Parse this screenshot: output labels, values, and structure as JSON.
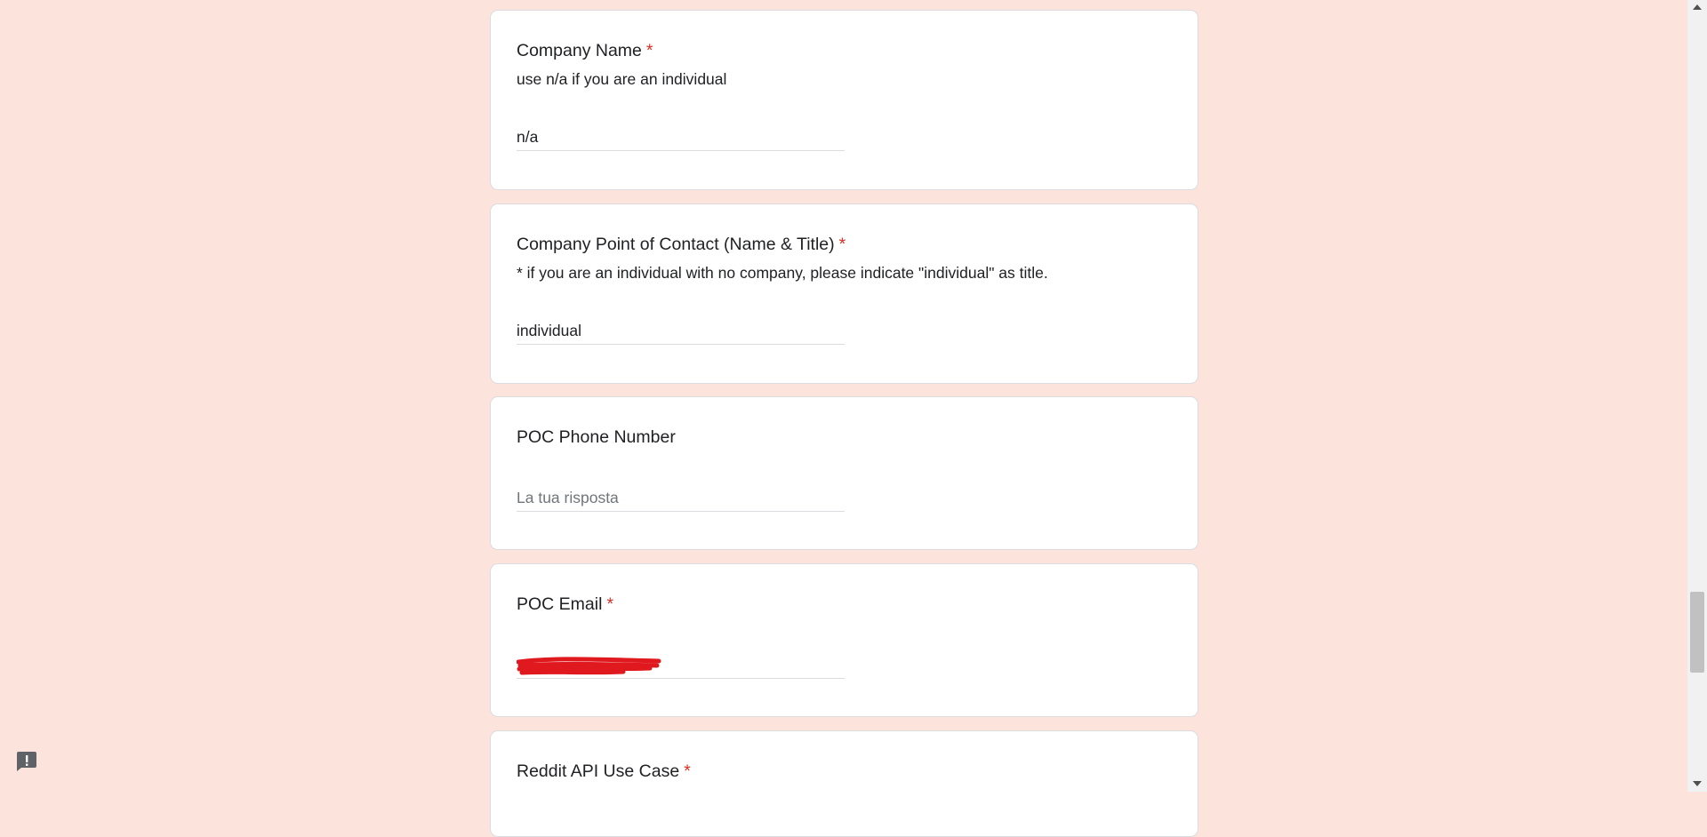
{
  "questions": {
    "company_name": {
      "title": "Company Name",
      "required": "*",
      "description": "use n/a if you are an individual",
      "value": "n/a"
    },
    "poc_contact": {
      "title": "Company Point of Contact (Name & Title)",
      "required": "*",
      "description": "* if you are an individual with no company, please indicate \"individual\" as title.",
      "value": "individual"
    },
    "poc_phone": {
      "title": "POC Phone Number",
      "placeholder": "La tua risposta"
    },
    "poc_email": {
      "title": "POC Email",
      "required": "*",
      "value": "[redacted]"
    },
    "api_use_case": {
      "title": "Reddit API Use Case",
      "required": "*"
    }
  },
  "icons": {
    "feedback": "report-feedback-icon",
    "scroll_up": "scroll-up-arrow-icon",
    "scroll_down": "scroll-down-arrow-icon"
  },
  "colors": {
    "background": "#fce4dc",
    "card": "#ffffff",
    "required": "#d93025",
    "redaction": "#e0191f"
  }
}
